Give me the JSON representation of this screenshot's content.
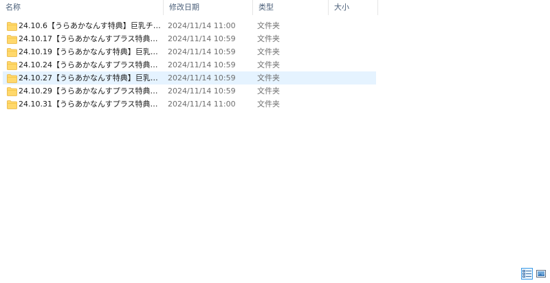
{
  "columns": {
    "name": "名称",
    "date": "修改日期",
    "type": "类型",
    "size": "大小"
  },
  "files": [
    {
      "name": "24.10.6【うらあかなんす特典】巨乳チ…",
      "date": "2024/11/14 11:00",
      "type": "文件夹",
      "size": ""
    },
    {
      "name": "24.10.17【うらあかなんすプラス特典】…",
      "date": "2024/11/14 10:59",
      "type": "文件夹",
      "size": ""
    },
    {
      "name": "24.10.19【うらあかなんす特典】巨乳チ…",
      "date": "2024/11/14 10:59",
      "type": "文件夹",
      "size": ""
    },
    {
      "name": "24.10.24【うらあかなんすプラス特典】…",
      "date": "2024/11/14 10:59",
      "type": "文件夹",
      "size": ""
    },
    {
      "name": "24.10.27【うらあかなんす特典】巨乳♡…",
      "date": "2024/11/14 10:59",
      "type": "文件夹",
      "size": ""
    },
    {
      "name": "24.10.29【うらあかなんすプラス特典】…",
      "date": "2024/11/14 10:59",
      "type": "文件夹",
      "size": ""
    },
    {
      "name": "24.10.31【うらあかなんすプラス特典】…",
      "date": "2024/11/14 11:00",
      "type": "文件夹",
      "size": ""
    }
  ],
  "hovered_row": 4,
  "sort_indicator": "^",
  "colors": {
    "folder_fill": "#ffd86b",
    "folder_edge": "#e8b33f",
    "hover_bg": "#e5f3ff",
    "accent": "#3c9be8"
  },
  "icons": {
    "folder": "folder-icon",
    "sort": "sort-ascending-icon",
    "details_view": "details-view-icon",
    "tiles_view": "large-icons-view-icon"
  }
}
